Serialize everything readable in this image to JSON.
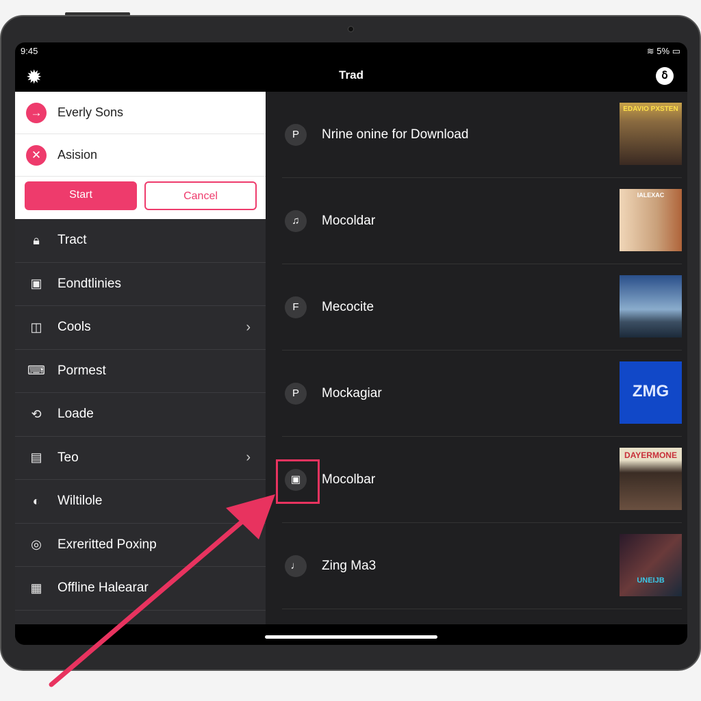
{
  "status": {
    "time": "9:45",
    "battery": "5%"
  },
  "header": {
    "title": "Trad",
    "left_icon": "gear-icon",
    "right_icon": "profile-icon",
    "right_glyph": "ẟ"
  },
  "popup": {
    "items": [
      {
        "label": "Everly Sons",
        "icon": "arrow-right-icon",
        "glyph": "→"
      },
      {
        "label": "Asision",
        "icon": "close-icon",
        "glyph": "✕"
      }
    ],
    "start_label": "Start",
    "cancel_label": "Cancel"
  },
  "menu": [
    {
      "label": "Tract",
      "glyph": "🔒︎",
      "icon": "lock-icon"
    },
    {
      "label": "Eondtlinies",
      "glyph": "▣",
      "icon": "card-icon"
    },
    {
      "label": "Cools",
      "glyph": "◫",
      "icon": "calendar-icon",
      "chevron": "›"
    },
    {
      "label": "Pormest",
      "glyph": "⌨",
      "icon": "keyboard-icon"
    },
    {
      "label": "Loade",
      "glyph": "⟲",
      "icon": "load-icon"
    },
    {
      "label": "Teo",
      "glyph": "▤",
      "icon": "briefcase-icon",
      "chevron": "›"
    },
    {
      "label": "Wiltilole",
      "glyph": "◐",
      "icon": "half-circle-icon"
    },
    {
      "label": "Exreritted Poxinp",
      "glyph": "◎",
      "icon": "target-icon"
    },
    {
      "label": "Offline Halearar",
      "glyph": "▦",
      "icon": "grid-icon"
    }
  ],
  "list": [
    {
      "label": "Nrine onine for Download",
      "glyph": "P",
      "art_text": "EDAVIO PXSTEN"
    },
    {
      "label": "Mocoldar",
      "glyph": "♫",
      "art_text": "IALEXAC"
    },
    {
      "label": "Mecocite",
      "glyph": "F",
      "art_text": ""
    },
    {
      "label": "Mockagiar",
      "glyph": "P",
      "art_text": "ZMG"
    },
    {
      "label": "Mocolbar",
      "glyph": "▣",
      "art_text": "DAYERMONE"
    },
    {
      "label": "Zing Ma3",
      "glyph": "♩",
      "art_text": "UNEIJB"
    }
  ],
  "colors": {
    "accent": "#ee3b6c",
    "annotation": "#e8335f"
  }
}
